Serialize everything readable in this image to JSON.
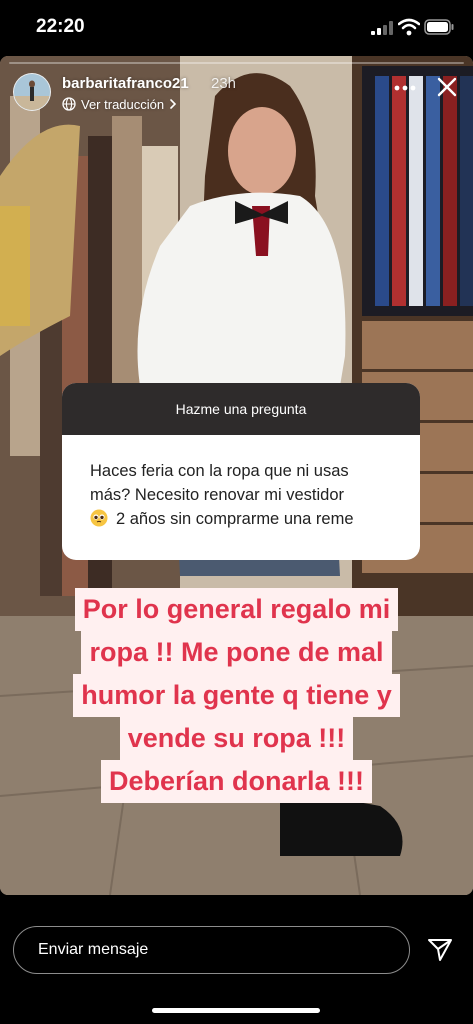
{
  "status_bar": {
    "time": "22:20",
    "icons": [
      "signal-icon",
      "wifi-icon",
      "battery-icon"
    ]
  },
  "story": {
    "progress": 0.0,
    "header": {
      "username": "barbaritafranco21",
      "time_ago": "23h",
      "translate_label": "Ver traducción",
      "icons": [
        "avatar",
        "globe-icon",
        "chevron-right-icon",
        "more-icon",
        "close-icon"
      ]
    },
    "question_sticker": {
      "title": "Hazme una pregunta",
      "lines": [
        "Haces feria con la ropa que ni usas",
        "más? Necesito renovar mi vestidor",
        "2 años sin comprarme una reme"
      ],
      "emoji": "pleading-face-icon"
    },
    "response": {
      "lines": [
        "Por lo general regalo mi",
        "ropa !! Me pone de mal",
        "humor la gente q  tiene  y",
        "vende su ropa !!!",
        "Deberían donarla  !!!"
      ],
      "text_color": "#e0344d",
      "highlight_color": "#fff0f0"
    }
  },
  "footer": {
    "message_placeholder": "Enviar mensaje",
    "icons": [
      "send-icon"
    ]
  }
}
